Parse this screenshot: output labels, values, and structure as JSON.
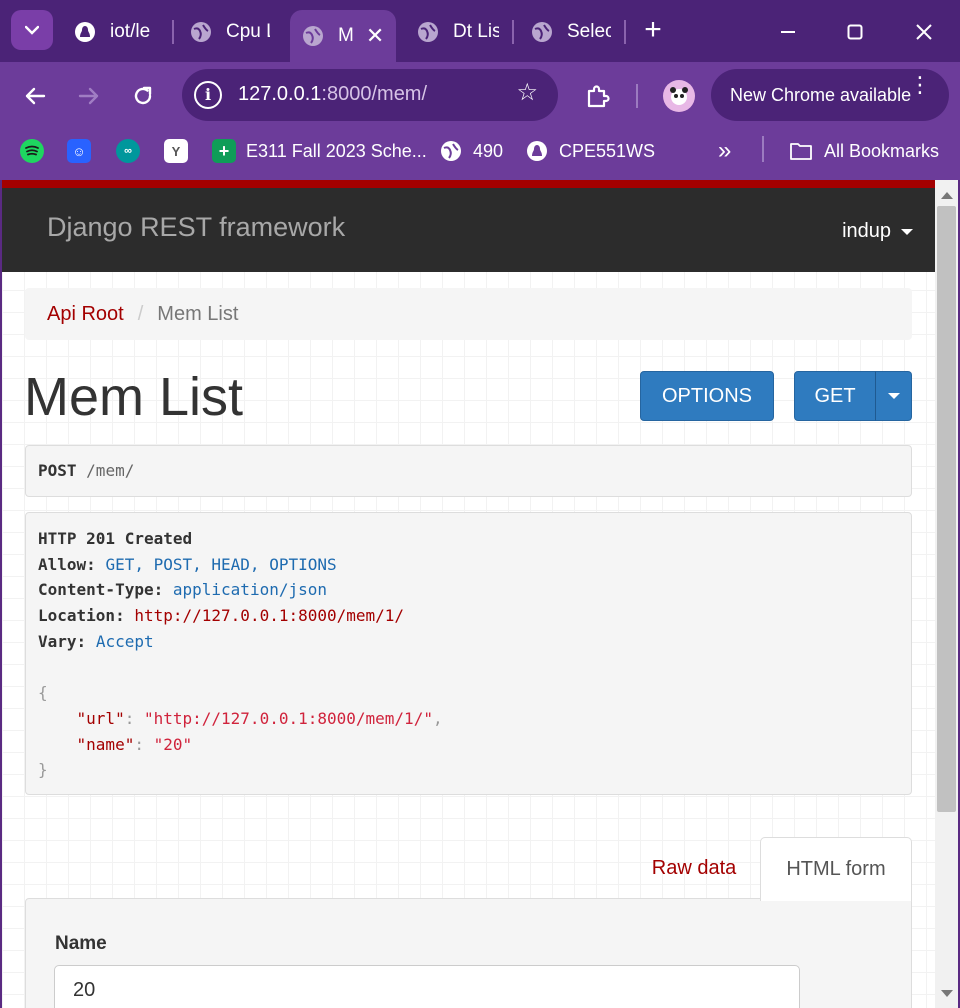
{
  "browser": {
    "tabs": [
      {
        "title": "iot/le",
        "icon": "github-icon"
      },
      {
        "title": "Cpu L",
        "icon": "globe-icon"
      },
      {
        "title": "M",
        "icon": "globe-icon",
        "active": true
      },
      {
        "title": "Dt Lis",
        "icon": "globe-icon"
      },
      {
        "title": "Selec",
        "icon": "globe-icon"
      }
    ],
    "new_tab_label": "+",
    "address": {
      "host": "127.0.0.1",
      "path": ":8000/mem/"
    },
    "update_label": "New Chrome available",
    "bookmarks": [
      {
        "label": "",
        "icon": "spotify-icon"
      },
      {
        "label": "",
        "icon": "bookmark-app-icon"
      },
      {
        "label": "",
        "icon": "arduino-icon"
      },
      {
        "label": "",
        "icon": "y-app-icon"
      },
      {
        "label": "E311 Fall 2023 Sche...",
        "icon": "sheets-icon"
      },
      {
        "label": "490",
        "icon": "globe-icon"
      },
      {
        "label": "CPE551WS",
        "icon": "github-icon"
      }
    ],
    "overflow_label": "»",
    "all_bookmarks_label": "All Bookmarks"
  },
  "page": {
    "brand": "Django REST framework",
    "user": "indup",
    "breadcrumb": {
      "root": "Api Root",
      "separator": "/",
      "current": "Mem List"
    },
    "title": "Mem List",
    "buttons": {
      "options": "OPTIONS",
      "get": "GET"
    },
    "request": {
      "method": "POST",
      "path": "/mem/"
    },
    "response": {
      "status": "HTTP 201 Created",
      "headers": [
        {
          "name": "Allow:",
          "value": "GET, POST, HEAD, OPTIONS"
        },
        {
          "name": "Content-Type:",
          "value": "application/json"
        },
        {
          "name": "Location:",
          "value": "http://127.0.0.1:8000/mem/1/"
        },
        {
          "name": "Vary:",
          "value": "Accept"
        }
      ],
      "body": {
        "open": "{",
        "close": "}",
        "fields": [
          {
            "key": "\"url\"",
            "value": "\"http://127.0.0.1:8000/mem/1/\"",
            "comma": ","
          },
          {
            "key": "\"name\"",
            "value": "\"20\"",
            "comma": ""
          }
        ]
      }
    },
    "tabs": {
      "raw": "Raw data",
      "html": "HTML form"
    },
    "form": {
      "name_label": "Name",
      "name_value": "20"
    }
  },
  "colors": {
    "accent_red": "#a30000",
    "button_blue": "#2f7bbf",
    "chrome_purple": "#6c3c9a"
  }
}
